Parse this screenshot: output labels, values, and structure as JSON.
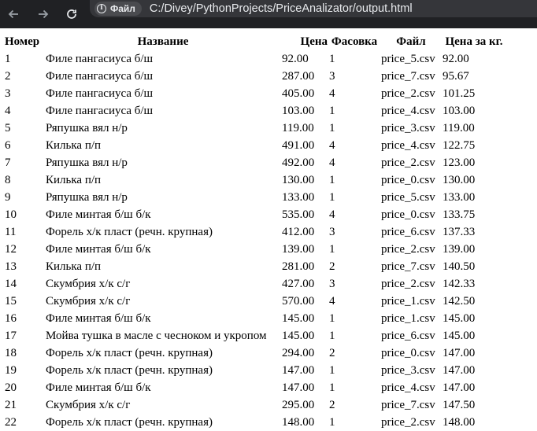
{
  "browser": {
    "chip_label": "Файл",
    "url": "C:/Divey/PythonProjects/PriceAnalizator/output.html"
  },
  "table": {
    "headers": [
      "Номер",
      "Название",
      "Цена",
      "Фасовка",
      "Файл",
      "Цена за кг."
    ],
    "rows": [
      [
        "1",
        "Филе пангасиуса б/ш",
        "92.00",
        "1",
        "price_5.csv",
        "92.00"
      ],
      [
        "2",
        "Филе пангасиуса б/ш",
        "287.00",
        "3",
        "price_7.csv",
        "95.67"
      ],
      [
        "3",
        "Филе пангасиуса б/ш",
        "405.00",
        "4",
        "price_2.csv",
        "101.25"
      ],
      [
        "4",
        "Филе пангасиуса б/ш",
        "103.00",
        "1",
        "price_4.csv",
        "103.00"
      ],
      [
        "5",
        "Ряпушка вял н/р",
        "119.00",
        "1",
        "price_3.csv",
        "119.00"
      ],
      [
        "6",
        "Килька п/п",
        "491.00",
        "4",
        "price_4.csv",
        "122.75"
      ],
      [
        "7",
        "Ряпушка вял н/р",
        "492.00",
        "4",
        "price_2.csv",
        "123.00"
      ],
      [
        "8",
        "Килька п/п",
        "130.00",
        "1",
        "price_0.csv",
        "130.00"
      ],
      [
        "9",
        "Ряпушка вял н/р",
        "133.00",
        "1",
        "price_5.csv",
        "133.00"
      ],
      [
        "10",
        "Филе минтая б/ш б/к",
        "535.00",
        "4",
        "price_0.csv",
        "133.75"
      ],
      [
        "11",
        "Форель х/к пласт (речн. крупная)",
        "412.00",
        "3",
        "price_6.csv",
        "137.33"
      ],
      [
        "12",
        "Филе минтая б/ш б/к",
        "139.00",
        "1",
        "price_2.csv",
        "139.00"
      ],
      [
        "13",
        "Килька п/п",
        "281.00",
        "2",
        "price_7.csv",
        "140.50"
      ],
      [
        "14",
        "Скумбрия х/к с/г",
        "427.00",
        "3",
        "price_2.csv",
        "142.33"
      ],
      [
        "15",
        "Скумбрия х/к с/г",
        "570.00",
        "4",
        "price_1.csv",
        "142.50"
      ],
      [
        "16",
        "Филе минтая б/ш б/к",
        "145.00",
        "1",
        "price_1.csv",
        "145.00"
      ],
      [
        "17",
        "Мойва тушка в масле с чесноком и укропом",
        "145.00",
        "1",
        "price_6.csv",
        "145.00"
      ],
      [
        "18",
        "Форель х/к пласт (речн. крупная)",
        "294.00",
        "2",
        "price_0.csv",
        "147.00"
      ],
      [
        "19",
        "Форель х/к пласт (речн. крупная)",
        "147.00",
        "1",
        "price_3.csv",
        "147.00"
      ],
      [
        "20",
        "Филе минтая б/ш б/к",
        "147.00",
        "1",
        "price_4.csv",
        "147.00"
      ],
      [
        "21",
        "Скумбрия х/к с/г",
        "295.00",
        "2",
        "price_7.csv",
        "147.50"
      ],
      [
        "22",
        "Форель х/к пласт (речн. крупная)",
        "148.00",
        "1",
        "price_2.csv",
        "148.00"
      ]
    ]
  }
}
